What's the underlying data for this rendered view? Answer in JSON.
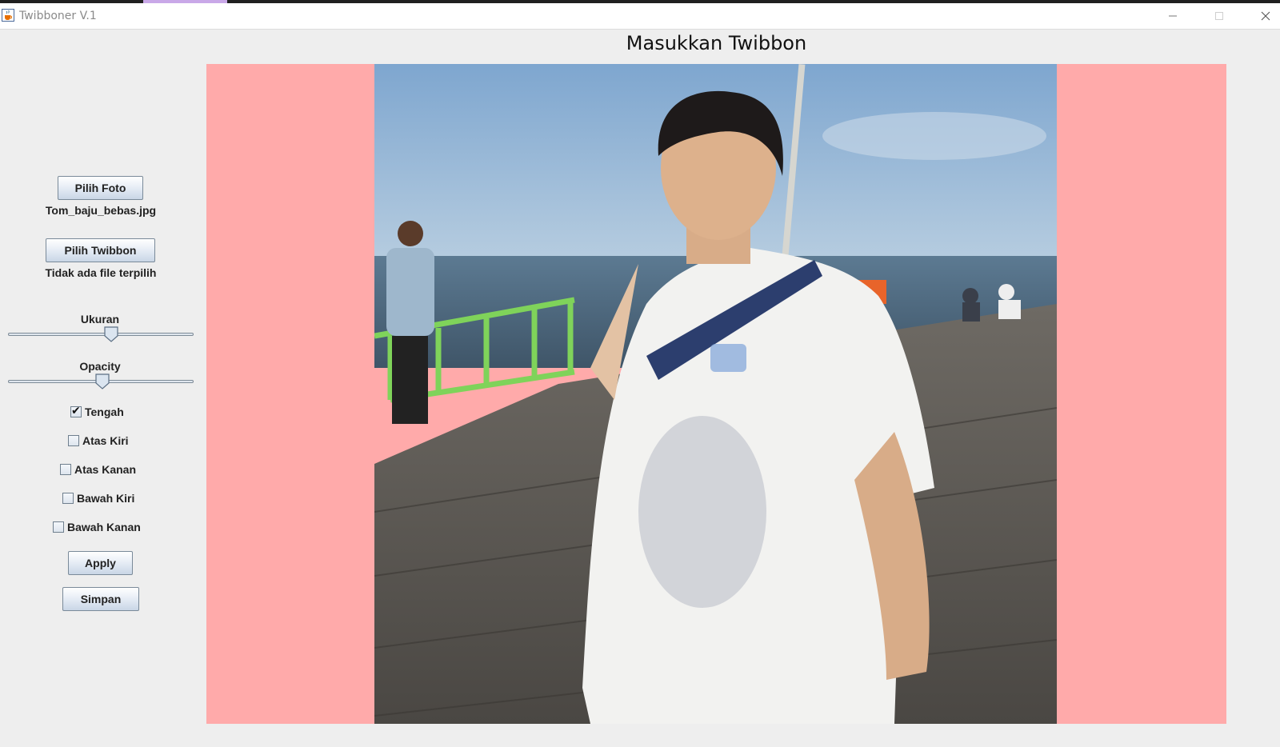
{
  "window": {
    "title": "Twibboner V.1",
    "controls": [
      "minimize",
      "maximize",
      "close"
    ]
  },
  "controls_panel": {
    "pick_photo_button": "Pilih Foto",
    "photo_filename": "Tom_baju_bebas.jpg",
    "pick_twibbon_button": "Pilih Twibbon",
    "twibbon_filename": "Tidak ada file terpilih",
    "size_label": "Ukuran",
    "size_value": 0.56,
    "opacity_label": "Opacity",
    "opacity_value": 0.51,
    "positions": [
      {
        "label": "Tengah",
        "checked": true
      },
      {
        "label": "Atas Kiri",
        "checked": false
      },
      {
        "label": "Atas Kanan",
        "checked": false
      },
      {
        "label": "Bawah Kiri",
        "checked": false
      },
      {
        "label": "Bawah Kanan",
        "checked": false
      }
    ],
    "apply_button": "Apply",
    "save_button": "Simpan"
  },
  "preview": {
    "heading": "Masukkan Twibbon",
    "background_color": "#ffaaaa"
  },
  "icons": {
    "app": "java-coffee-cup-icon",
    "minimize": "minimize-icon",
    "maximize": "maximize-icon",
    "close": "close-icon"
  }
}
